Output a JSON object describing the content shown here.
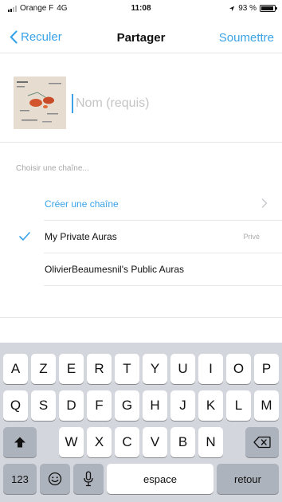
{
  "status_bar": {
    "carrier": "Orange F",
    "network": "4G",
    "time": "11:08",
    "battery_text": "93 %",
    "battery_level": 0.93
  },
  "nav": {
    "back_label": "Reculer",
    "title": "Partager",
    "submit_label": "Soumettre"
  },
  "name_field": {
    "value": "",
    "placeholder": "Nom (requis)"
  },
  "channels": {
    "section_label": "Choisir une chaîne...",
    "items": [
      {
        "label": "Créer une chaîne",
        "privacy": "",
        "selected": false,
        "action": true
      },
      {
        "label": "My Private Auras",
        "privacy": "Privé",
        "selected": true,
        "action": false
      },
      {
        "label": "OlivierBeaumesnil's Public Auras",
        "privacy": "",
        "selected": false,
        "action": false
      }
    ]
  },
  "keyboard": {
    "row1": [
      "A",
      "Z",
      "E",
      "R",
      "T",
      "Y",
      "U",
      "I",
      "O",
      "P"
    ],
    "row2": [
      "Q",
      "S",
      "D",
      "F",
      "G",
      "H",
      "J",
      "K",
      "L",
      "M"
    ],
    "row3": [
      "W",
      "X",
      "C",
      "V",
      "B",
      "N"
    ],
    "numbers_label": "123",
    "space_label": "espace",
    "return_label": "retour"
  },
  "colors": {
    "accent": "#3aa3e8",
    "keyboard_bg": "#d3d6dc",
    "key_bg": "#ffffff",
    "special_key_bg": "#adb3bc"
  },
  "icons": {
    "back": "chevron-left-icon",
    "chevron": "chevron-right-icon",
    "check": "checkmark-icon",
    "shift": "shift-icon",
    "delete": "delete-backspace-icon",
    "emoji": "emoji-icon",
    "dictation": "microphone-icon",
    "location": "location-arrow-icon"
  }
}
